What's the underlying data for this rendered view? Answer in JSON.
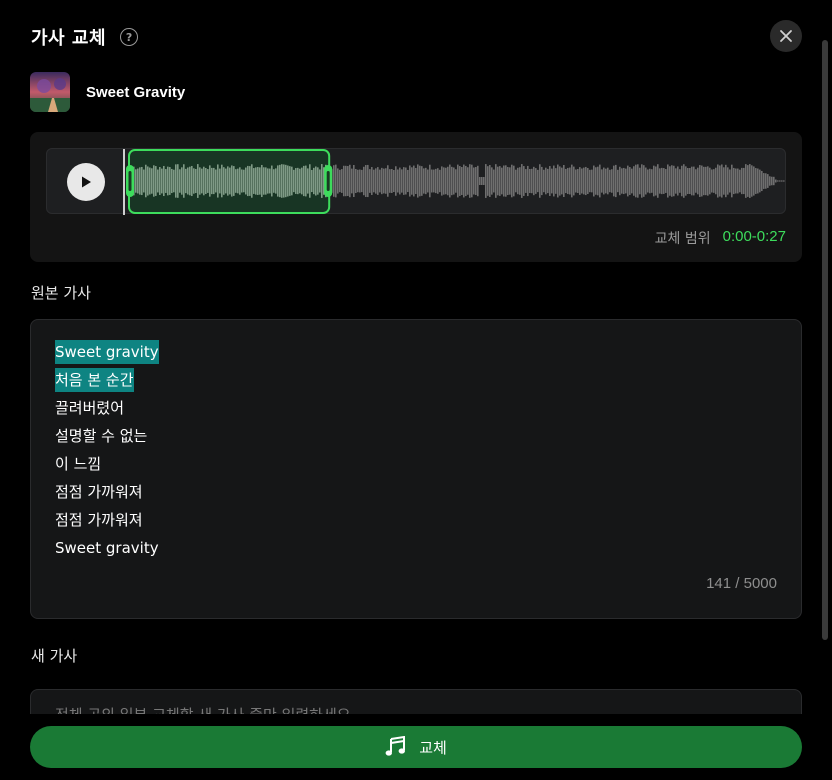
{
  "dialog": {
    "title": "가사 교체",
    "help_icon": "question-circle-icon",
    "close_icon": "close-icon"
  },
  "track": {
    "title": "Sweet Gravity",
    "cover_icon": "album-cover-image"
  },
  "waveform": {
    "play_icon": "play-icon",
    "selection_start_fraction": 0.0,
    "selection_end_fraction": 0.3,
    "range_label": "교체 범위",
    "range_value": "0:00-0:27",
    "accent_color": "#3ddc5c"
  },
  "original_lyrics": {
    "label": "원본 가사",
    "lines": [
      {
        "text": "Sweet gravity",
        "highlighted": true
      },
      {
        "text": "처음 본 순간",
        "highlighted": true
      },
      {
        "text": "끌려버렸어",
        "highlighted": false
      },
      {
        "text": "설명할 수 없는",
        "highlighted": false
      },
      {
        "text": "이 느낌",
        "highlighted": false
      },
      {
        "text": "점점 가까워져",
        "highlighted": false
      },
      {
        "text": "점점 가까워져",
        "highlighted": false
      },
      {
        "text": "Sweet gravity",
        "highlighted": false
      }
    ],
    "counter": "141 / 5000",
    "highlight_color": "#0e8482"
  },
  "new_lyrics": {
    "label": "새 가사",
    "placeholder": "전체 곡의 일부 교체할 새 가사 줄만 입력하세요",
    "value": ""
  },
  "submit": {
    "label": "교체",
    "icon": "music-notes-icon",
    "color": "#1a7a35"
  }
}
